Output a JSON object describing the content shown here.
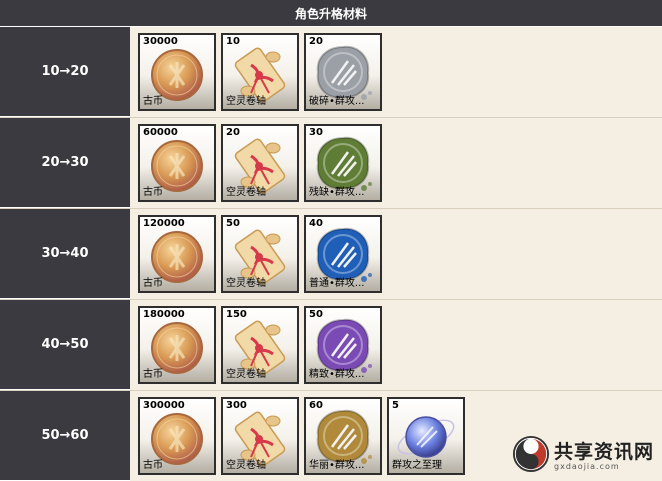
{
  "header": {
    "title": "角色升格材料"
  },
  "rows": [
    {
      "level": "10→20",
      "items": [
        {
          "qty": "30000",
          "name": "古币",
          "icon": "coin-icon"
        },
        {
          "qty": "10",
          "name": "空灵卷轴",
          "icon": "scroll-icon"
        },
        {
          "qty": "20",
          "name": "破碎•群攻...",
          "icon": "wax-seal-icon",
          "color": "#9aa0a6"
        }
      ]
    },
    {
      "level": "20→30",
      "items": [
        {
          "qty": "60000",
          "name": "古币",
          "icon": "coin-icon"
        },
        {
          "qty": "20",
          "name": "空灵卷轴",
          "icon": "scroll-icon"
        },
        {
          "qty": "30",
          "name": "残缺•群攻...",
          "icon": "wax-seal-icon",
          "color": "#5f7d35"
        }
      ]
    },
    {
      "level": "30→40",
      "items": [
        {
          "qty": "120000",
          "name": "古币",
          "icon": "coin-icon"
        },
        {
          "qty": "50",
          "name": "空灵卷轴",
          "icon": "scroll-icon"
        },
        {
          "qty": "40",
          "name": "普通•群攻...",
          "icon": "wax-seal-icon",
          "color": "#1f5fb8"
        }
      ]
    },
    {
      "level": "40→50",
      "items": [
        {
          "qty": "180000",
          "name": "古币",
          "icon": "coin-icon"
        },
        {
          "qty": "150",
          "name": "空灵卷轴",
          "icon": "scroll-icon"
        },
        {
          "qty": "50",
          "name": "精致•群攻...",
          "icon": "wax-seal-icon",
          "color": "#7b4bb5"
        }
      ]
    },
    {
      "level": "50→60",
      "items": [
        {
          "qty": "300000",
          "name": "古币",
          "icon": "coin-icon"
        },
        {
          "qty": "300",
          "name": "空灵卷轴",
          "icon": "scroll-icon"
        },
        {
          "qty": "60",
          "name": "华丽•群攻...",
          "icon": "wax-seal-icon",
          "color": "#b08a3a"
        },
        {
          "qty": "5",
          "name": "群攻之至理",
          "icon": "crystal-orb-icon",
          "color": "#6a7fe0"
        }
      ]
    }
  ],
  "watermark": {
    "title": "共享资讯网",
    "subtitle": "gxdaojia.com",
    "icon": "logo-icon"
  }
}
